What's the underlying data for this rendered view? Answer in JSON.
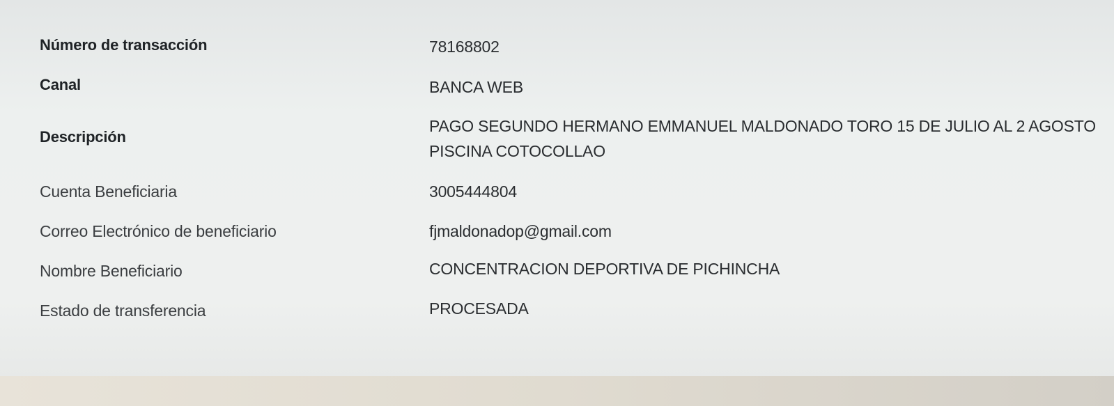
{
  "details": {
    "transaction_number": {
      "label": "Número de transacción",
      "value": "78168802"
    },
    "channel": {
      "label": "Canal",
      "value": "BANCA WEB"
    },
    "description": {
      "label": "Descripción",
      "value_line1": "PAGO SEGUNDO HERMANO EMMANUEL MALDONADO TORO 15 DE JULIO AL 2 AGOSTO",
      "value_line2": "PISCINA COTOCOLLAO"
    },
    "beneficiary_account": {
      "label": "Cuenta Beneficiaria",
      "value": "3005444804"
    },
    "beneficiary_email": {
      "label": "Correo Electrónico de beneficiario",
      "value": "fjmaldonadop@gmail.com"
    },
    "beneficiary_name": {
      "label": "Nombre Beneficiario",
      "value": "CONCENTRACION DEPORTIVA DE PICHINCHA"
    },
    "transfer_status": {
      "label": "Estado de transferencia",
      "value": "PROCESADA"
    }
  }
}
